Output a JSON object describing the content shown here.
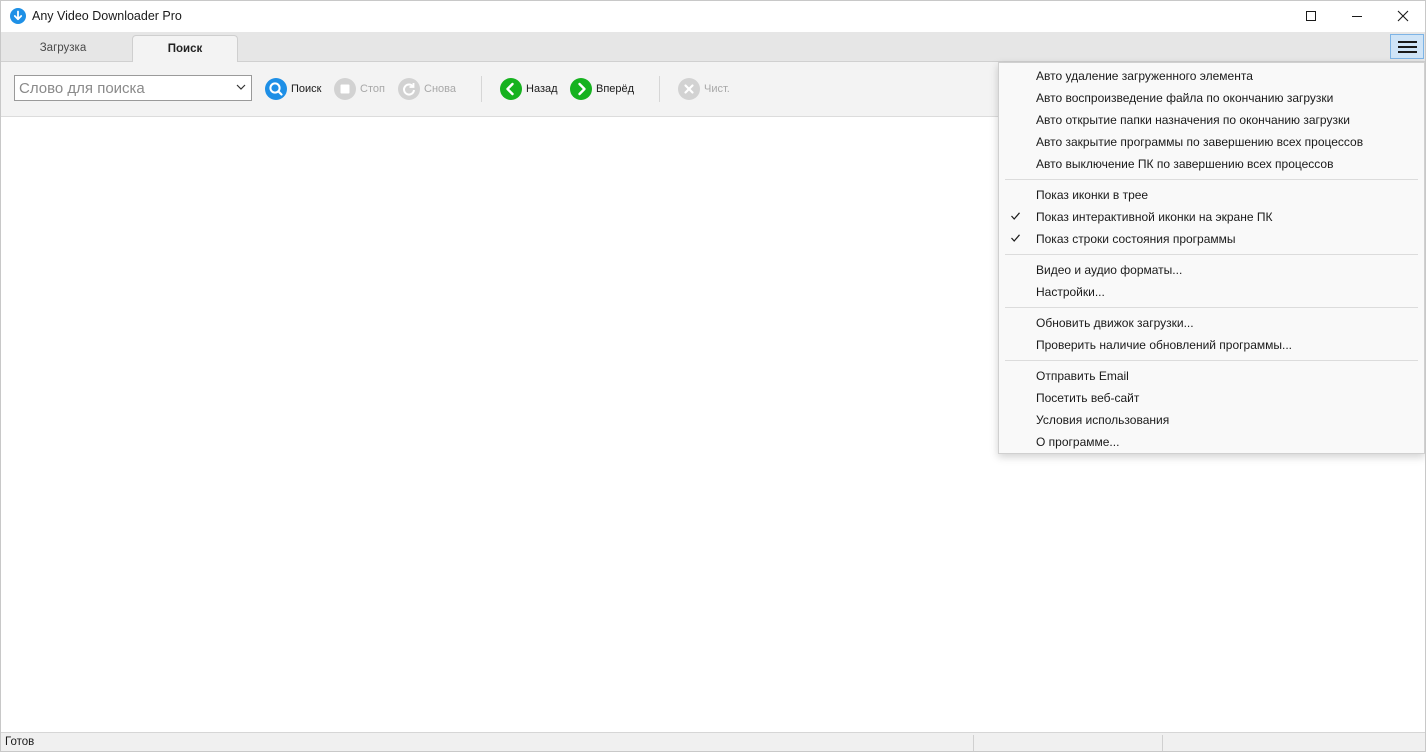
{
  "window": {
    "title": "Any Video Downloader Pro"
  },
  "tabs": [
    {
      "label": "Загрузка",
      "active": false
    },
    {
      "label": "Поиск",
      "active": true
    }
  ],
  "toolbar": {
    "search_placeholder": "Слово для поиска",
    "search_label": "Поиск",
    "stop_label": "Стоп",
    "again_label": "Снова",
    "back_label": "Назад",
    "forward_label": "Вперёд",
    "clear_label": "Чист."
  },
  "menu": {
    "groups": [
      {
        "items": [
          {
            "label": "Авто удаление загруженного элемента",
            "checked": false
          },
          {
            "label": "Авто воспроизведение файла по окончанию загрузки",
            "checked": false
          },
          {
            "label": "Авто открытие папки назначения по окончанию загрузки",
            "checked": false
          },
          {
            "label": "Авто закрытие программы по завершению всех процессов",
            "checked": false
          },
          {
            "label": "Авто выключение ПК по завершению всех процессов",
            "checked": false
          }
        ]
      },
      {
        "items": [
          {
            "label": "Показ иконки в трее",
            "checked": false
          },
          {
            "label": "Показ интерактивной иконки на экране ПК",
            "checked": true
          },
          {
            "label": "Показ строки состояния программы",
            "checked": true
          }
        ]
      },
      {
        "items": [
          {
            "label": "Видео и аудио форматы...",
            "checked": false
          },
          {
            "label": "Настройки...",
            "checked": false
          }
        ]
      },
      {
        "items": [
          {
            "label": "Обновить движок загрузки...",
            "checked": false
          },
          {
            "label": "Проверить наличие обновлений программы...",
            "checked": false
          }
        ]
      },
      {
        "items": [
          {
            "label": "Отправить Email",
            "checked": false
          },
          {
            "label": "Посетить веб-сайт",
            "checked": false
          },
          {
            "label": "Условия использования",
            "checked": false
          },
          {
            "label": "О программе...",
            "checked": false
          }
        ]
      }
    ]
  },
  "status": {
    "text": "Готов"
  },
  "colors": {
    "accent_blue": "#1e8fe6",
    "accent_green": "#16b21f",
    "disabled_gray": "#d2d2d2"
  },
  "icons": {
    "app": "download-arrow-icon",
    "search": "magnifier-icon",
    "stop": "stop-square-icon",
    "again": "refresh-icon",
    "back": "chevron-left-icon",
    "forward": "chevron-right-icon",
    "clear": "close-x-icon",
    "menu": "hamburger-icon"
  }
}
